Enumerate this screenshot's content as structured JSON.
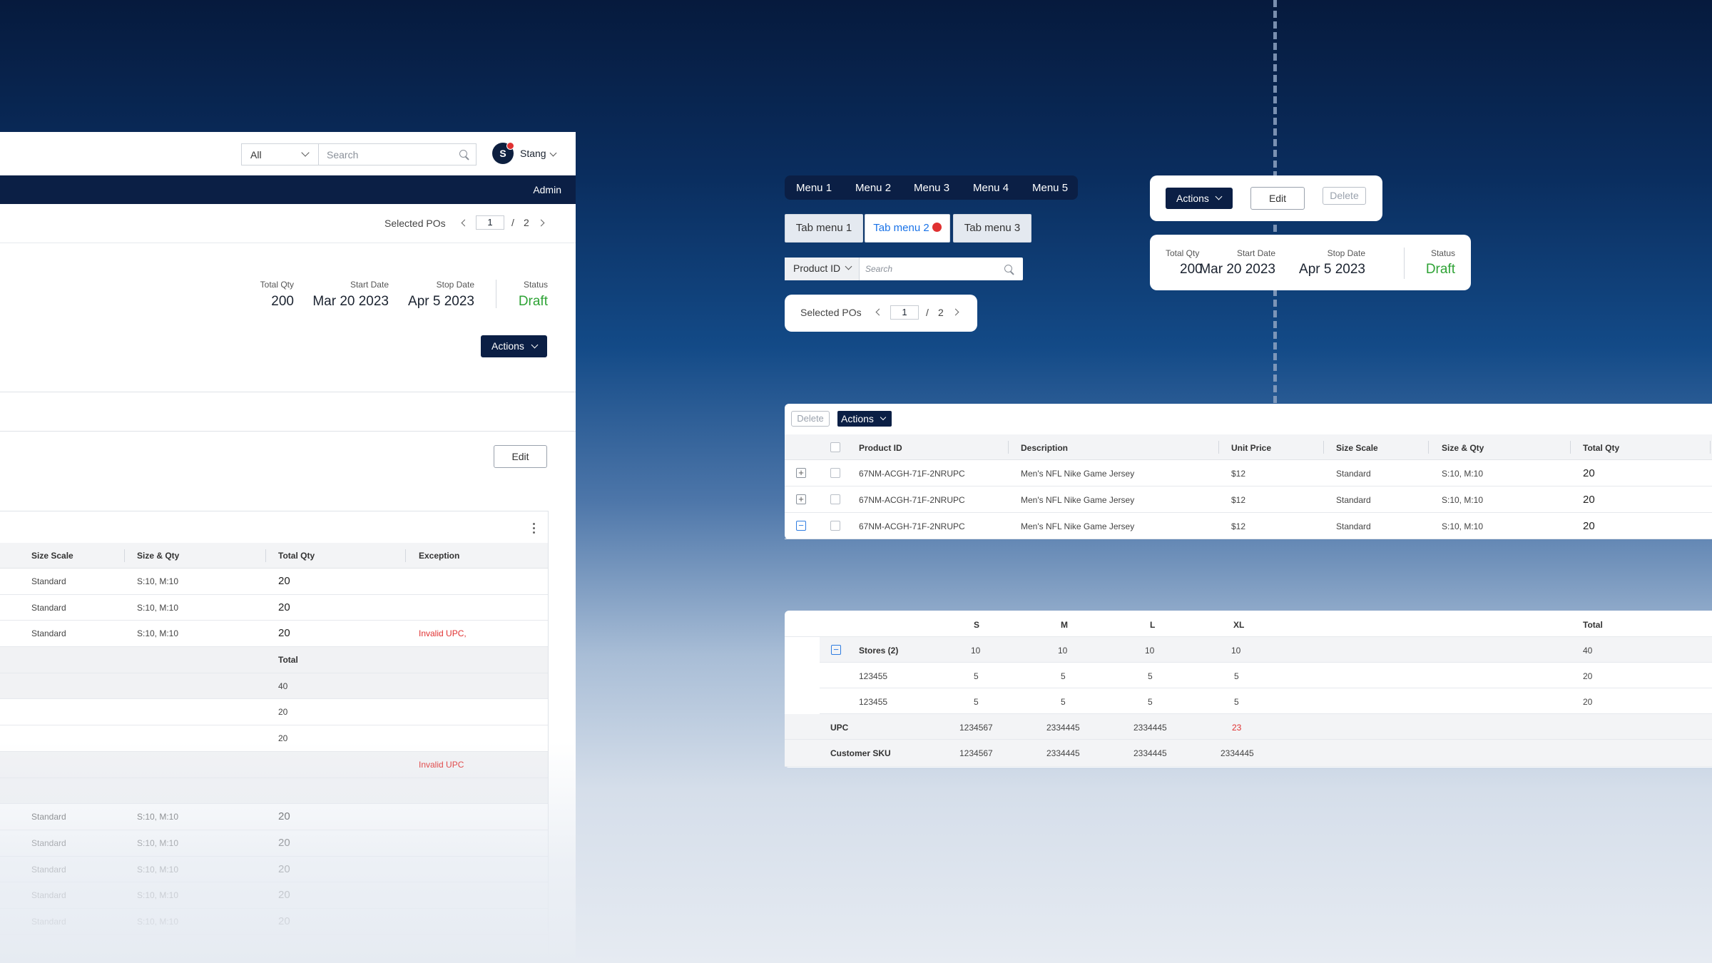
{
  "app": {
    "filter_select": "All",
    "search_placeholder": "Search",
    "user_initial": "S",
    "user_name": "Stang",
    "role": "Admin",
    "selected_pos_label": "Selected POs",
    "page_current": "1",
    "page_sep": "/",
    "page_total": "2",
    "stats": {
      "total_qty_label": "Total Qty",
      "total_qty": "200",
      "start_label": "Start Date",
      "start": "Mar 20 2023",
      "stop_label": "Stop Date",
      "stop": "Apr 5 2023",
      "status_label": "Status",
      "status": "Draft"
    },
    "actions_label": "Actions",
    "edit_label": "Edit",
    "table": {
      "headers": [
        "Size Scale",
        "Size & Qty",
        "Total Qty",
        "Exception"
      ],
      "rows": [
        {
          "scale": "Standard",
          "sizes": "S:10, M:10",
          "qty": "20",
          "exception": ""
        },
        {
          "scale": "Standard",
          "sizes": "S:10, M:10",
          "qty": "20",
          "exception": ""
        },
        {
          "scale": "Standard",
          "sizes": "S:10, M:10",
          "qty": "20",
          "exception": "Invalid UPC,"
        }
      ],
      "sub_total_header": "Total",
      "sub_rows": [
        "40",
        "20",
        "20"
      ],
      "sub_exception": "Invalid UPC",
      "lower_rows": [
        {
          "scale": "Standard",
          "sizes": "S:10, M:10",
          "qty": "20"
        },
        {
          "scale": "Standard",
          "sizes": "S:10, M:10",
          "qty": "20"
        },
        {
          "scale": "Standard",
          "sizes": "S:10, M:10",
          "qty": "20"
        },
        {
          "scale": "Standard",
          "sizes": "S:10, M:10",
          "qty": "20"
        },
        {
          "scale": "Standard",
          "sizes": "S:10, M:10",
          "qty": "20"
        }
      ]
    }
  },
  "components": {
    "menus": [
      "Menu 1",
      "Menu 2",
      "Menu 3",
      "Menu 4",
      "Menu 5"
    ],
    "tabs": [
      "Tab menu 1",
      "Tab menu 2",
      "Tab menu 3"
    ],
    "product_select": "Product ID",
    "search_placeholder": "Search",
    "selected_pos_label": "Selected POs",
    "page_current": "1",
    "page_sep": "/",
    "page_total": "2",
    "actions_label": "Actions",
    "edit_label": "Edit",
    "delete_label": "Delete",
    "stats": {
      "total_qty_label": "Total Qty",
      "total_qty": "200",
      "start_label": "Start Date",
      "start": "Mar 20 2023",
      "stop_label": "Stop Date",
      "stop": "Apr 5 2023",
      "status_label": "Status",
      "status": "Draft"
    },
    "product_table": {
      "delete_label": "Delete",
      "actions_label": "Actions",
      "headers": [
        "Product ID",
        "Description",
        "Unit Price",
        "Size Scale",
        "Size & Qty",
        "Total Qty"
      ],
      "rows": [
        {
          "id": "67NM-ACGH-71F-2NRUPC",
          "desc": "Men's NFL Nike Game Jersey",
          "price": "$12",
          "scale": "Standard",
          "sizes": "S:10, M:10",
          "qty": "20"
        },
        {
          "id": "67NM-ACGH-71F-2NRUPC",
          "desc": "Men's NFL Nike Game Jersey",
          "price": "$12",
          "scale": "Standard",
          "sizes": "S:10, M:10",
          "qty": "20"
        },
        {
          "id": "67NM-ACGH-71F-2NRUPC",
          "desc": "Men's NFL Nike Game Jersey",
          "price": "$12",
          "scale": "Standard",
          "sizes": "S:10, M:10",
          "qty": "20"
        }
      ]
    },
    "size_table": {
      "headers": [
        "S",
        "M",
        "L",
        "XL",
        "Total"
      ],
      "stores_label": "Stores (2)",
      "stores_values": [
        "10",
        "10",
        "10",
        "10",
        "40"
      ],
      "store_rows": [
        {
          "id": "123455",
          "values": [
            "5",
            "5",
            "5",
            "5",
            "20"
          ]
        },
        {
          "id": "123455",
          "values": [
            "5",
            "5",
            "5",
            "5",
            "20"
          ]
        }
      ],
      "upc_label": "UPC",
      "upc_values": [
        "1234567",
        "2334445",
        "2334445",
        "23"
      ],
      "sku_label": "Customer SKU",
      "sku_values": [
        "1234567",
        "2334445",
        "2334445",
        "2334445"
      ]
    }
  }
}
